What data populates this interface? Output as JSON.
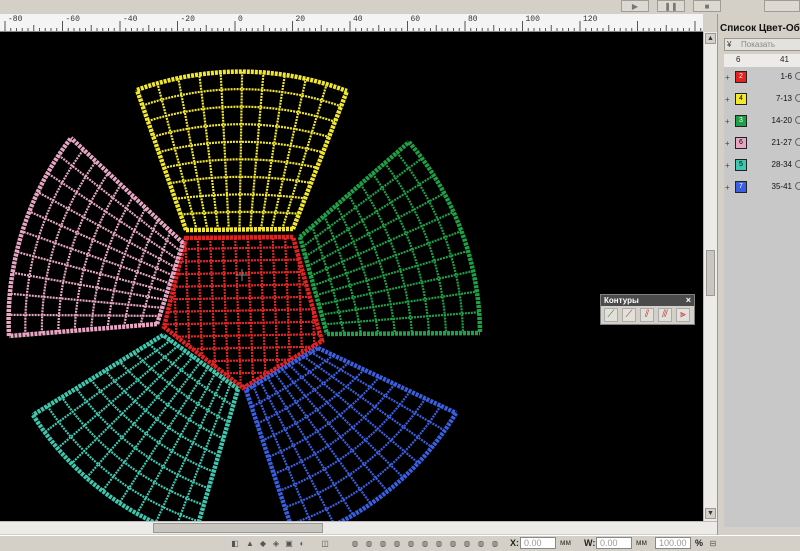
{
  "toolbar": {
    "play_icon": "play-icon",
    "pause_icon": "pause-icon",
    "stop_icon": "stop-icon"
  },
  "ruler": {
    "labels": [
      "-80",
      "-60",
      "-40",
      "-20",
      "0",
      "20",
      "40",
      "60",
      "80",
      "100",
      "120"
    ]
  },
  "canvas": {
    "background": "#000000",
    "segments": [
      {
        "name": "yellow-segment",
        "color": "#f2e82f"
      },
      {
        "name": "pink-segment",
        "color": "#e7a6c2"
      },
      {
        "name": "green-segment",
        "color": "#1ea046"
      },
      {
        "name": "red-segment",
        "color": "#e32322"
      },
      {
        "name": "teal-segment",
        "color": "#3fc8b0"
      },
      {
        "name": "blue-segment",
        "color": "#3a5fe0"
      }
    ]
  },
  "panel": {
    "title": "Список Цвет-Объект",
    "show_button": "Показать",
    "col_left": "6",
    "col_right": "41",
    "rows": [
      {
        "num": "2",
        "color": "#e32322",
        "range": "1-6"
      },
      {
        "num": "4",
        "color": "#f2e82f",
        "range": "7-13"
      },
      {
        "num": "3",
        "color": "#1ea046",
        "range": "14-20"
      },
      {
        "num": "6",
        "color": "#e7a6c2",
        "range": "21-27"
      },
      {
        "num": "5",
        "color": "#3fc8b0",
        "range": "28-34"
      },
      {
        "num": "7",
        "color": "#3a5fe0",
        "range": "35-41"
      }
    ]
  },
  "palette": {
    "title": "Контуры",
    "close": "×"
  },
  "status": {
    "x_label": "X:",
    "x_value": "0.00",
    "x_unit": "мм",
    "w_label": "W:",
    "w_value": "0.00",
    "w_unit": "мм",
    "scale_value": "100.00",
    "scale_unit": "%"
  }
}
